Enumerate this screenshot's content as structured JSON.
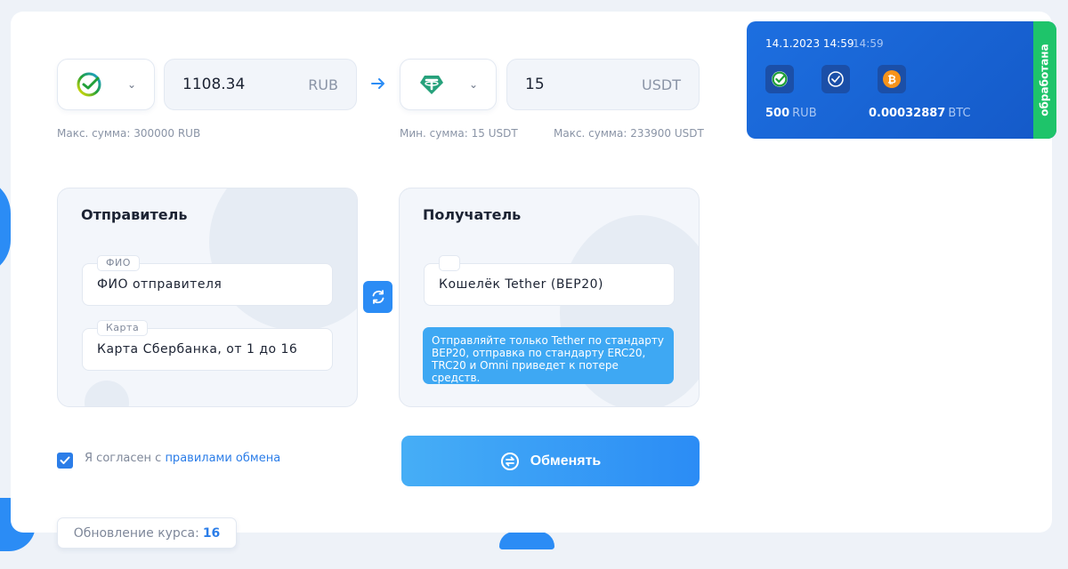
{
  "from": {
    "amount": "1108.34",
    "currency": "RUB",
    "max_hint": "Макс. сумма: 300000 RUB",
    "icon": "sberbank-icon"
  },
  "to": {
    "amount": "15",
    "currency": "USDT",
    "min_hint": "Мин. сумма: 15 USDT",
    "max_hint": "Макс. сумма: 233900 USDT",
    "icon": "tether-icon"
  },
  "sender": {
    "title": "Отправитель",
    "name_label": "ФИО",
    "name_value": "ФИО отправителя",
    "card_label": "Карта",
    "card_value": "Карта Сбербанка, от 1 до 16"
  },
  "receiver": {
    "title": "Получатель",
    "wallet_label": "",
    "wallet_value": "Кошелёк Tether (BEP20)",
    "notice": "Отправляйте только Tether по стандарту BEP20, отправка по стандарту ERC20, TRC20 и Omni приведет к потере средств."
  },
  "agreement": {
    "prefix": "Я согласен с ",
    "link": "правилами обмена",
    "checked": true
  },
  "exchange_button": "Обменять",
  "rate_update": {
    "label": "Обновление курса:",
    "value": "16"
  },
  "order": {
    "date": "14.1.2023 14:59",
    "time": "14:59",
    "from_amount": "500",
    "from_currency": "RUB",
    "to_amount": "0.00032887",
    "to_currency": "BTC",
    "status": "обработана"
  },
  "colors": {
    "accent": "#2b8cf5",
    "success": "#1ec46a",
    "sber": "#21a038",
    "tether": "#26a17b",
    "bitcoin": "#f7931a"
  }
}
